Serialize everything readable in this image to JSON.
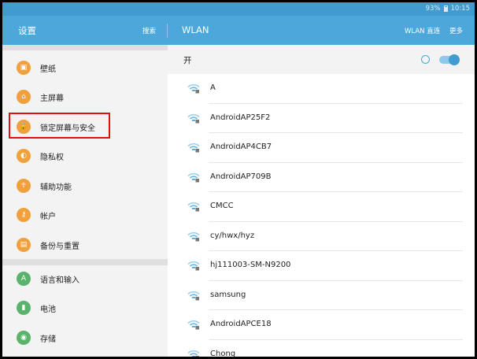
{
  "status_bar": {
    "battery": "93%",
    "time": "10:15"
  },
  "app_bar": {
    "settings_title": "设置",
    "search_label": "搜索",
    "wlan_title": "WLAN",
    "wlan_direct_label": "WLAN 直连",
    "more_label": "更多"
  },
  "sidebar": {
    "group1": [
      {
        "label": "壁纸",
        "icon": "wallpaper-icon"
      },
      {
        "label": "主屏幕",
        "icon": "home-icon"
      },
      {
        "label": "锁定屏幕与安全",
        "icon": "lock-icon"
      },
      {
        "label": "隐私权",
        "icon": "privacy-icon"
      },
      {
        "label": "辅助功能",
        "icon": "accessibility-icon"
      },
      {
        "label": "帐户",
        "icon": "key-icon"
      },
      {
        "label": "备份与重置",
        "icon": "backup-icon"
      }
    ],
    "group2": [
      {
        "label": "语言和输入",
        "icon": "language-icon"
      },
      {
        "label": "电池",
        "icon": "battery-icon"
      },
      {
        "label": "存储",
        "icon": "storage-icon"
      }
    ],
    "selected": "锁定屏幕与安全"
  },
  "wlan": {
    "toggle_label": "开",
    "enabled": true,
    "networks": [
      "A",
      "AndroidAP25F2",
      "AndroidAP4CB7",
      "AndroidAP709B",
      "CMCC",
      "cy/hwx/hyz",
      "hj111003-SM-N9200",
      "samsung",
      "AndroidAPCE18",
      "Chong"
    ]
  },
  "colors": {
    "accent": "#4ca7db",
    "status_bar": "#3f9bd0",
    "icon_orange": "#f0a03c",
    "icon_green": "#5ab36a",
    "highlight": "#e01010"
  }
}
